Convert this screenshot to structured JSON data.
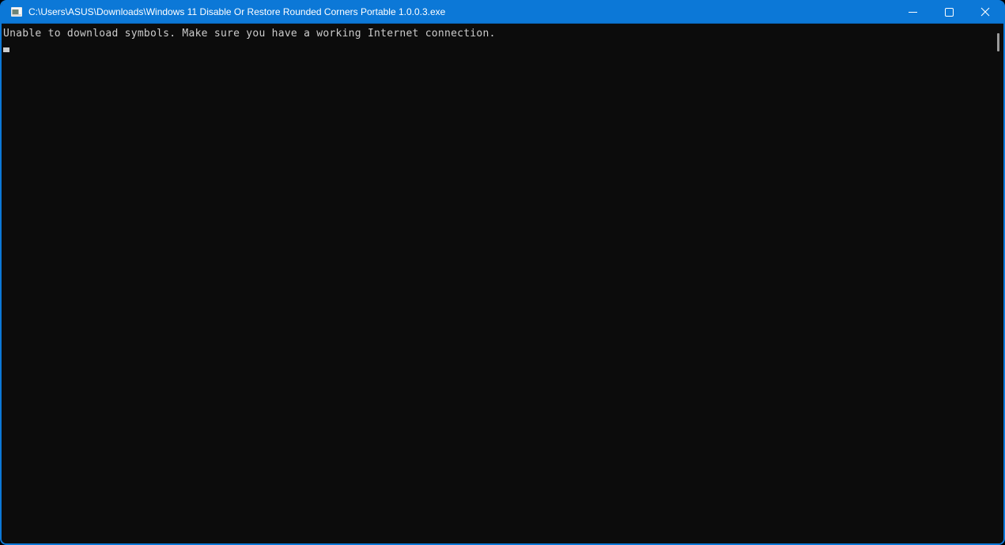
{
  "window": {
    "title": "C:\\Users\\ASUS\\Downloads\\Windows 11 Disable Or Restore Rounded Corners Portable 1.0.0.3.exe",
    "controls": {
      "minimize_icon": "minimize-icon",
      "maximize_icon": "maximize-icon",
      "close_icon": "close-icon"
    },
    "app_icon": "console-window-icon"
  },
  "console": {
    "lines": [
      "Unable to download symbols. Make sure you have a working Internet connection."
    ],
    "cursor_visible": true
  },
  "colors": {
    "titlebar_accent": "#0c78d7",
    "window_border": "#0c78d7",
    "console_background": "#0c0c0c",
    "console_text": "#cccccc",
    "caption_glyph": "#ffffff",
    "scrollbar_thumb": "#9a9a9a"
  }
}
